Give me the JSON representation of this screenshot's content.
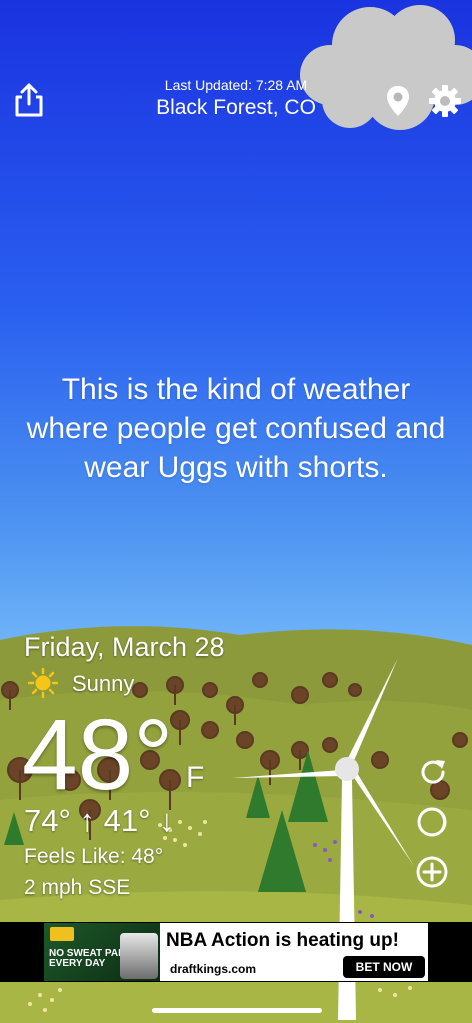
{
  "header": {
    "last_updated": "Last Updated: 7:28 AM",
    "location": "Black Forest, CO",
    "share_icon": "share-icon",
    "location_icon": "location-pin-icon",
    "settings_icon": "gear-icon"
  },
  "quote": "This is the kind of weather where people get confused and wear Uggs with shorts.",
  "forecast": {
    "date": "Friday, March 28",
    "condition_icon": "sun-icon",
    "condition": "Sunny",
    "temperature": "48°",
    "unit": "F",
    "high_low": "74° ↑  41° ↓",
    "feels_like": "Feels Like: 48°",
    "wind": "2 mph SSE"
  },
  "side_buttons": {
    "refresh_icon": "refresh-icon",
    "moon_icon": "moon-phase-icon",
    "add_icon": "plus-circle-icon"
  },
  "ad": {
    "image_line1": "NO SWEAT PARLAY",
    "image_line2": "EVERY DAY",
    "headline": "NBA Action is heating up!",
    "site": "draftkings.com",
    "cta": "BET NOW"
  },
  "colors": {
    "sky_top": "#1a33e0",
    "sky_bottom": "#7fc0f8",
    "hill": "#8a9a3a",
    "tree_green": "#2f7a2c"
  }
}
